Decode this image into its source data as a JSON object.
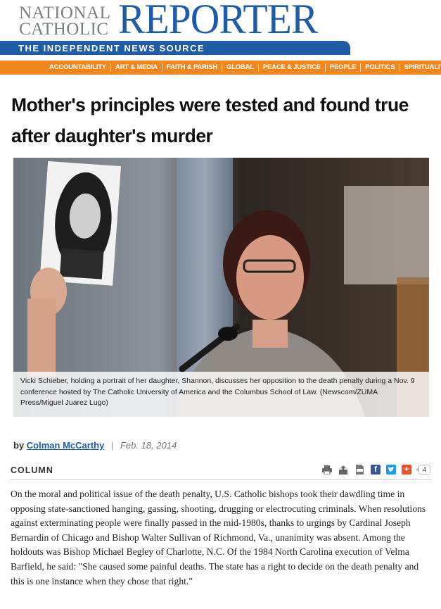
{
  "masthead": {
    "brand_line1": "NATIONAL",
    "brand_line2": "CATHOLIC",
    "brand_main": "REPORTER",
    "tagline": "THE INDEPENDENT NEWS SOURCE",
    "brand_color": "#1f5ca6"
  },
  "nav": {
    "color": "#f2861e",
    "items": [
      "ACCOUNTABILITY",
      "ART & MEDIA",
      "FAITH & PARISH",
      "GLOBAL",
      "PEACE & JUSTICE",
      "PEOPLE",
      "POLITICS",
      "SPIRITUALITY"
    ]
  },
  "article": {
    "headline": "Mother's principles were tested and found true after daughter's murder",
    "photo_caption": "Vicki Schieber, holding a portrait of her daughter, Shannon, discusses her opposition to the death penalty during a Nov. 9 conference hosted by The Catholic University of America and the Columbus School of Law. (Newscom/ZUMA Press/Miguel Juarez Lugo)",
    "byline_prefix": "by",
    "author": "Colman McCarthy",
    "date": "Feb. 18, 2014",
    "section": "COLUMN",
    "share_count": "4",
    "body": "On the moral and political issue of the death penalty, U.S. Catholic bishops took their dawdling time in opposing state-sanctioned hanging, gassing, shooting, drugging or electrocuting criminals. When resolutions against exterminating people were finally passed in the mid-1980s, thanks to urgings by Cardinal Joseph Bernardin of Chicago and Bishop Walter Sullivan of Richmond, Va., unanimity was absent. Among the holdouts was Bishop Michael Begley of Charlotte, N.C. Of the 1984 North Carolina execution of Velma Barfield, he said: \"She caused some painful deaths. The state has a right to decide on the death penalty and this is one instance when they chose that right.\""
  },
  "tools": [
    "print-icon",
    "share-icon",
    "pdf-icon",
    "facebook-icon",
    "twitter-icon",
    "plus-icon"
  ]
}
